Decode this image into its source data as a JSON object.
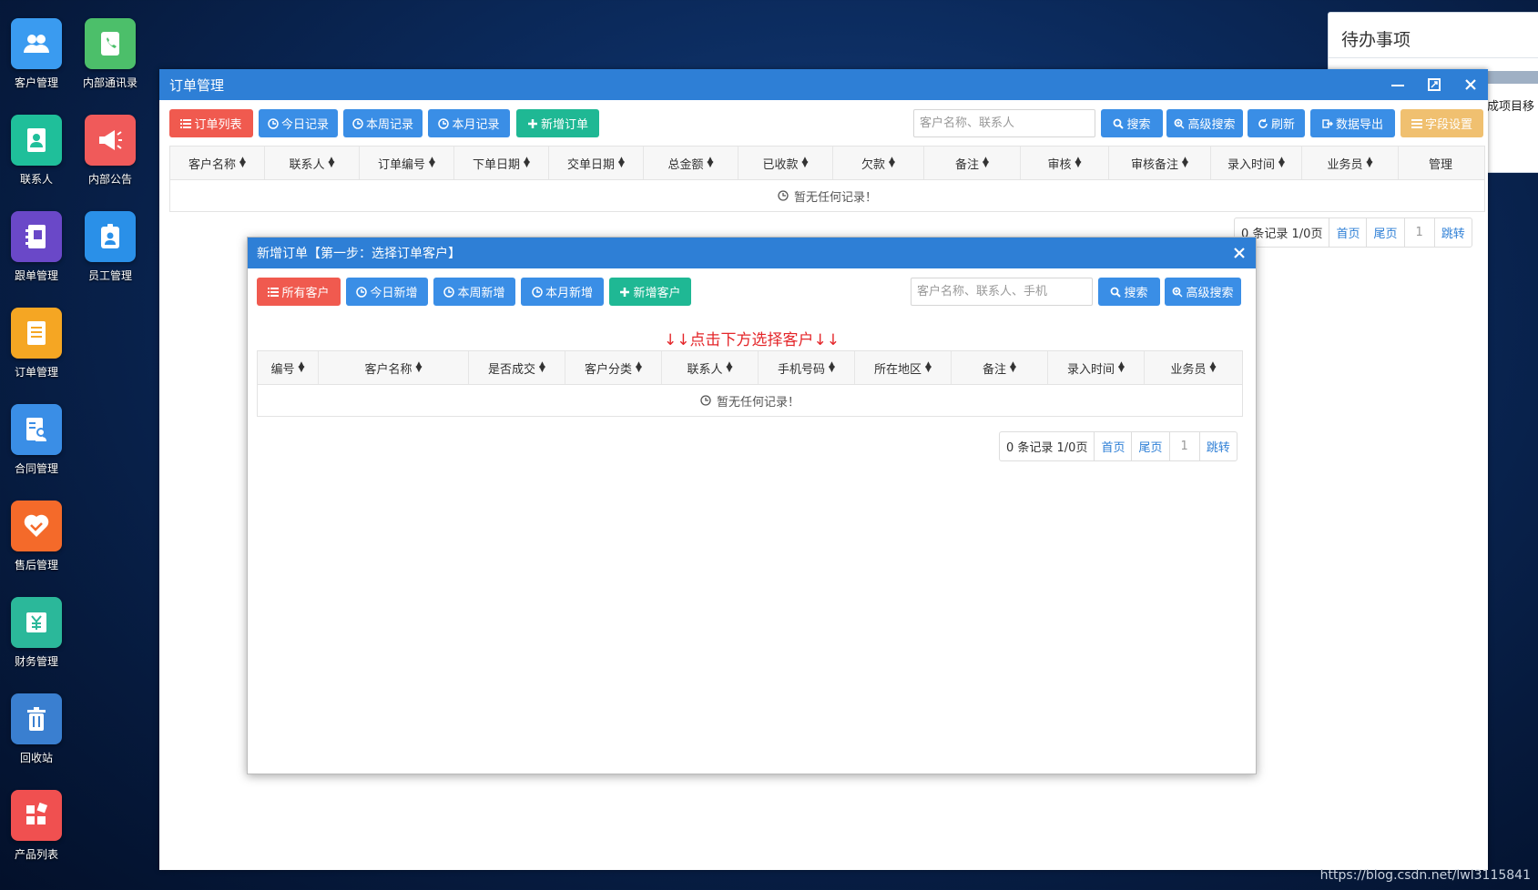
{
  "desktop": {
    "icons": [
      {
        "label": "客户管理",
        "icon": "users-icon",
        "color": "#3a9bf0"
      },
      {
        "label": "内部通讯录",
        "icon": "phone-book-icon",
        "color": "#4cbf6a"
      },
      {
        "label": "联系人",
        "icon": "contact-card-icon",
        "color": "#1fbf9a"
      },
      {
        "label": "内部公告",
        "icon": "megaphone-icon",
        "color": "#f05a5a"
      },
      {
        "label": "跟单管理",
        "icon": "notebook-icon",
        "color": "#6a48c8"
      },
      {
        "label": "员工管理",
        "icon": "employee-badge-icon",
        "color": "#2a90e8"
      },
      {
        "label": "订单管理",
        "icon": "document-list-icon",
        "color": "#f5a623"
      },
      {
        "label": "合同管理",
        "icon": "contract-icon",
        "color": "#3a8ee6"
      },
      {
        "label": "售后管理",
        "icon": "heart-handshake-icon",
        "color": "#f46a2a"
      },
      {
        "label": "财务管理",
        "icon": "finance-yen-icon",
        "color": "#2bb89a"
      },
      {
        "label": "回收站",
        "icon": "trash-icon",
        "color": "#3a7fd0"
      },
      {
        "label": "产品列表",
        "icon": "product-grid-icon",
        "color": "#f05050"
      }
    ]
  },
  "todo": {
    "title": "待办事项",
    "fragment": "成项目移"
  },
  "order_window": {
    "title": "订单管理",
    "toolbar": {
      "list": "订单列表",
      "today": "今日记录",
      "week": "本周记录",
      "month": "本月记录",
      "new_order": "新增订单",
      "search_placeholder": "客户名称、联系人",
      "search": "搜索",
      "advanced": "高级搜索",
      "refresh": "刷新",
      "export": "数据导出",
      "fields": "字段设置"
    },
    "columns": [
      "客户名称",
      "联系人",
      "订单编号",
      "下单日期",
      "交单日期",
      "总金额",
      "已收款",
      "欠款",
      "备注",
      "审核",
      "审核备注",
      "录入时间",
      "业务员",
      "管理"
    ],
    "empty": "暂无任何记录！",
    "pager": {
      "records": "0 条记录 1/0页",
      "first": "首页",
      "last": "尾页",
      "page": "1",
      "jump": "跳转"
    }
  },
  "modal": {
    "title": "新增订单【第一步：选择订单客户】",
    "toolbar": {
      "all": "所有客户",
      "today": "今日新增",
      "week": "本周新增",
      "month": "本月新增",
      "new_customer": "新增客户",
      "search_placeholder": "客户名称、联系人、手机",
      "search": "搜索",
      "advanced": "高级搜索"
    },
    "hint": "↓↓点击下方选择客户↓↓",
    "columns": [
      "编号",
      "客户名称",
      "是否成交",
      "客户分类",
      "联系人",
      "手机号码",
      "所在地区",
      "备注",
      "录入时间",
      "业务员"
    ],
    "empty": "暂无任何记录！",
    "pager": {
      "records": "0 条记录 1/0页",
      "first": "首页",
      "last": "尾页",
      "page": "1",
      "jump": "跳转"
    }
  },
  "watermark": "https://blog.csdn.net/lwl3115841"
}
